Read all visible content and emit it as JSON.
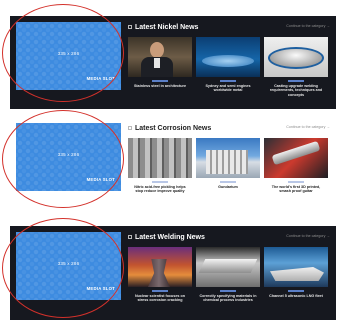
{
  "media_slot": {
    "size": "335 x 286",
    "label": "MEDIA SLOT"
  },
  "sections": [
    {
      "id": "nickel",
      "title": "Latest Nickel News",
      "more_link": "Continue to the category →",
      "cards": [
        {
          "caption": "Stainless steel in architecture",
          "image": "man-portrait"
        },
        {
          "caption": "Sydney and semi engines worldwide metal",
          "image": "blue-disc"
        },
        {
          "caption": "Casting upgrade welding requirements, techniques and concepts",
          "image": "metal-pipe"
        }
      ]
    },
    {
      "id": "corrosion",
      "title": "Latest Corrosion News",
      "more_link": "Continue to the category →",
      "cards": [
        {
          "caption": "Nitric acid-free pickling helps stop reduce improve quality",
          "image": "metal-rods"
        },
        {
          "caption": "Gundarium",
          "image": "building"
        },
        {
          "caption": "The world's first 3D printed, smash proof guitar",
          "image": "guitar"
        }
      ]
    },
    {
      "id": "welding",
      "title": "Latest Welding News",
      "more_link": "Continue to the category →",
      "cards": [
        {
          "caption": "Nuclear scientist focuses on stress corrosion cracking",
          "image": "cooling-tower"
        },
        {
          "caption": "Correctly specifying materials in chemical process industries",
          "image": "steel-beam"
        },
        {
          "caption": "Channel 5 ultrasonic LNG fleet",
          "image": "ship"
        }
      ]
    }
  ]
}
